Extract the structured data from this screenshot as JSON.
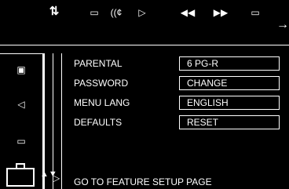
{
  "toolbar": {
    "icons": [
      {
        "name": "setup-icon",
        "glyph": "⇅"
      },
      {
        "name": "subtitle-icon",
        "glyph": "▭"
      },
      {
        "name": "audio-icon",
        "glyph": "((¢"
      },
      {
        "name": "play-icon",
        "glyph": "▷"
      },
      {
        "name": "rewind-icon",
        "glyph": "◀◀"
      },
      {
        "name": "fast-forward-icon",
        "glyph": "▶▶"
      },
      {
        "name": "display-icon",
        "glyph": "▭"
      }
    ],
    "arrow_glyph": "→"
  },
  "sidebar": {
    "icons": [
      {
        "name": "user-icon",
        "glyph": "▣"
      },
      {
        "name": "speaker-icon",
        "glyph": "◁"
      },
      {
        "name": "speech-bubble-icon",
        "glyph": "▭"
      }
    ],
    "selected_icon_name": "briefcase-icon",
    "updown_glyph": "▲▼",
    "play_glyph": "▷"
  },
  "settings": {
    "rows": [
      {
        "label": "PARENTAL",
        "value": "6 PG-R"
      },
      {
        "label": "PASSWORD",
        "value": "CHANGE"
      },
      {
        "label": "MENU LANG",
        "value": "ENGLISH"
      },
      {
        "label": "DEFAULTS",
        "value": "RESET"
      }
    ]
  },
  "status": {
    "text": "GO TO FEATURE SETUP PAGE"
  }
}
